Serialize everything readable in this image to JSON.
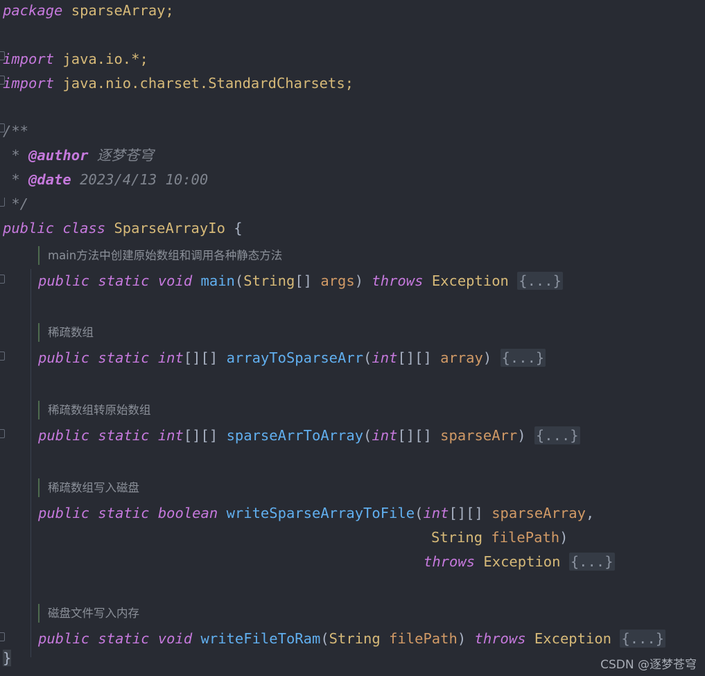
{
  "editor": {
    "language": "java",
    "theme": "darcula",
    "background_color": "#282b33",
    "fold_placeholder": "{...}"
  },
  "code": {
    "package_keyword": "package",
    "package_name": " sparseArray;",
    "import_keyword": "import",
    "import_io": " java.io.*;",
    "import_charsets": " java.nio.charset.StandardCharsets;",
    "javadoc": {
      "open": "/**",
      "author_star": " * ",
      "author_tag": "@author",
      "author_value": " 逐梦苍穹",
      "date_star": " * ",
      "date_tag": "@date",
      "date_value": " 2023/4/13 10:00",
      "close": " */"
    },
    "class_decl": {
      "public": "public",
      "class": "class",
      "name": "SparseArrayIo",
      "brace": "{"
    },
    "class_close_brace": "}",
    "methods": [
      {
        "doc_hint": "main方法中创建原始数组和调用各种静态方法",
        "modifier_public": "public",
        "modifier_static": "static",
        "return_type": "void",
        "name": "main",
        "param_type": "String",
        "param_brackets": "[]",
        "param_name": "args",
        "throws_keyword": "throws",
        "throws_type": "Exception",
        "body": "{...}"
      },
      {
        "doc_hint": "稀疏数组",
        "modifier_public": "public",
        "modifier_static": "static",
        "return_type": "int",
        "return_brackets": "[][]",
        "name": "arrayToSparseArr",
        "param_type": "int",
        "param_brackets": "[][]",
        "param_name": "array",
        "body": "{...}"
      },
      {
        "doc_hint": "稀疏数组转原始数组",
        "modifier_public": "public",
        "modifier_static": "static",
        "return_type": "int",
        "return_brackets": "[][]",
        "name": "sparseArrToArray",
        "param_type": "int",
        "param_brackets": "[][]",
        "param_name": "sparseArr",
        "body": "{...}"
      },
      {
        "doc_hint": "稀疏数组写入磁盘",
        "modifier_public": "public",
        "modifier_static": "static",
        "return_type": "boolean",
        "name": "writeSparseArrayToFile",
        "param_type": "int",
        "param_brackets": "[][]",
        "param_name": "sparseArray",
        "param2_type": "String",
        "param2_name": "filePath",
        "throws_keyword": "throws",
        "throws_type": "Exception",
        "body": "{...}"
      },
      {
        "doc_hint": "磁盘文件写入内存",
        "modifier_public": "public",
        "modifier_static": "static",
        "return_type": "void",
        "name": "writeFileToRam",
        "param_type": "String",
        "param_name": "filePath",
        "throws_keyword": "throws",
        "throws_type": "Exception",
        "body": "{...}"
      }
    ]
  },
  "watermark": {
    "text": "CSDN @逐梦苍穹"
  },
  "colors": {
    "keyword": "#c679dd",
    "identifier": "#d6b978",
    "method": "#61afef",
    "parameter": "#d19a66",
    "comment": "#7f848e",
    "punctuation": "#a9b2c3",
    "fold_background": "#353b45",
    "background": "#282b33"
  }
}
